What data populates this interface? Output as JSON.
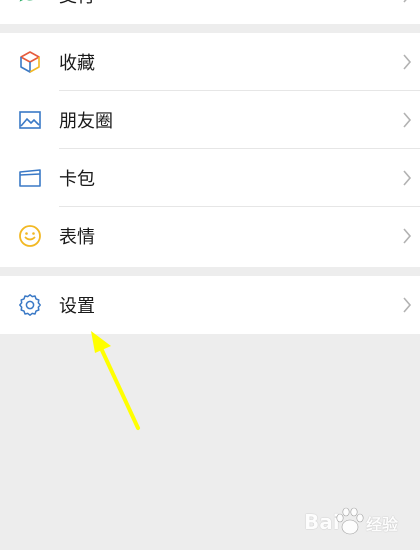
{
  "top_row": {
    "label": "支付"
  },
  "menu": {
    "group1": [
      {
        "label": "收藏",
        "icon": "favorites-cube-icon"
      },
      {
        "label": "朋友圈",
        "icon": "moments-photo-icon"
      },
      {
        "label": "卡包",
        "icon": "card-wallet-icon"
      },
      {
        "label": "表情",
        "icon": "sticker-smiley-icon"
      }
    ],
    "group2": [
      {
        "label": "设置",
        "icon": "settings-gear-icon"
      }
    ]
  },
  "watermark": {
    "bai": "Bai",
    "jingyan": "经验"
  },
  "colors": {
    "background": "#ededed",
    "row": "#ffffff",
    "text": "#1a1a1a",
    "chevron": "#b2b2b2",
    "icon_blue": "#3a79c6",
    "icon_gold": "#f2b823",
    "arrow": "#ffff00"
  }
}
